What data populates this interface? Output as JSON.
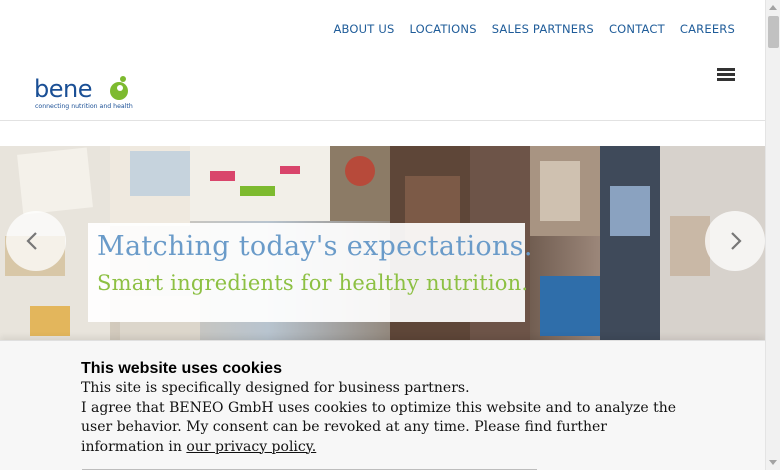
{
  "top_nav": {
    "items": [
      "ABOUT US",
      "LOCATIONS",
      "SALES PARTNERS",
      "CONTACT",
      "CAREERS"
    ]
  },
  "logo": {
    "word": "bene",
    "tagline": "connecting nutrition and health"
  },
  "hero": {
    "title": "Matching today's expectations.",
    "subtitle": "Smart ingredients for healthy nutrition."
  },
  "cookie_banner": {
    "title": "This website uses cookies",
    "line1": "This site is specifically designed for business partners.",
    "body": "I agree that BENEO GmbH uses cookies to optimize this website and to analyze the user behavior. My consent can be revoked at any time. Please find further information in",
    "link": "our privacy policy."
  },
  "colors": {
    "nav_text": "#1f5c99",
    "logo_blue": "#1a4f95",
    "logo_green": "#7dba2f",
    "hero_title": "#6a9bc9",
    "hero_subtitle": "#8dc043"
  },
  "icons": {
    "menu": "hamburger-menu-icon",
    "prev": "chevron-left-icon",
    "next": "chevron-right-icon"
  }
}
